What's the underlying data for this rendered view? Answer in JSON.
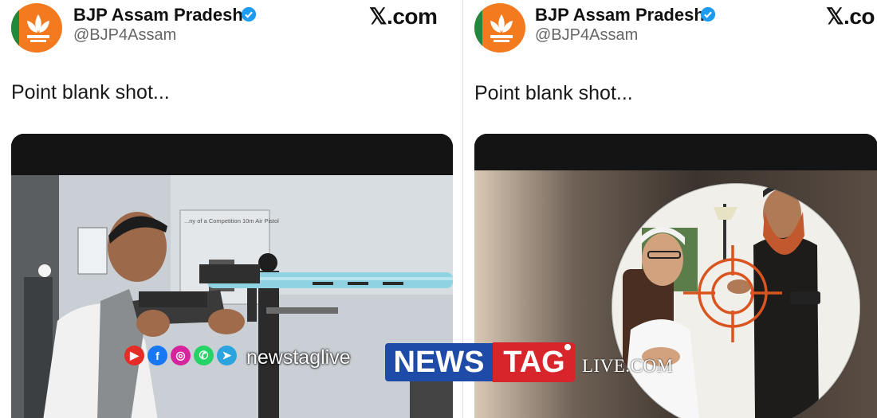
{
  "posts": [
    {
      "account_name": "BJP Assam Pradesh",
      "handle": "@BJP4Assam",
      "site": "𝕏.com",
      "text": "Point blank shot..."
    },
    {
      "account_name": "BJP Assam Pradesh",
      "handle": "@BJP4Assam",
      "site": "𝕏.co",
      "text": "Point blank shot..."
    }
  ],
  "left_media": {
    "wall_sign": "...ny of a Competition 10m Air Pistol"
  },
  "watermark": {
    "social_icons": [
      "youtube-icon",
      "facebook-icon",
      "instagram-icon",
      "whatsapp-icon",
      "telegram-icon"
    ],
    "social_label": "newstaglive",
    "logo_part1": "NEWS",
    "logo_part2": "TAG",
    "logo_suffix": "LIVE.COM"
  },
  "colors": {
    "verified_blue": "#1d9bf0",
    "bjp_saffron": "#f47a20",
    "logo_blue": "#1e4aa8",
    "logo_red": "#d8252b",
    "crosshair_orange": "#d9541e"
  }
}
